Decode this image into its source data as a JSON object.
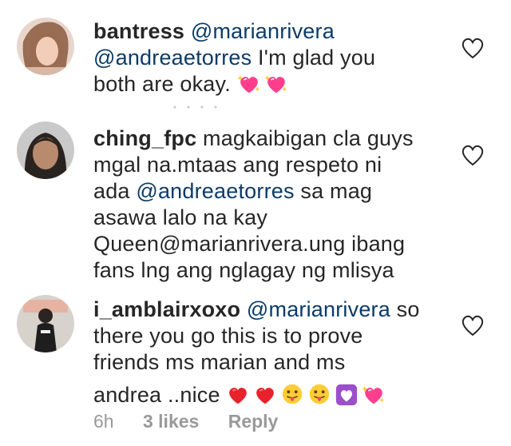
{
  "comments": [
    {
      "username": "bantress",
      "lines": [
        [
          {
            "t": "mention",
            "v": "@marianrivera"
          }
        ],
        [
          {
            "t": "mention",
            "v": "@andreaetorres"
          },
          {
            "t": "text",
            "v": " I'm glad you"
          }
        ],
        [
          {
            "t": "text",
            "v": "both are okay. "
          }
        ]
      ],
      "emojis": [
        "sparkling-heart",
        "sparkling-heart"
      ]
    },
    {
      "username": "ching_fpc",
      "line1_text": " magkaibigan cla guys",
      "line2": "mgal na.mtaas ang respeto ni",
      "line3_pre": "ada ",
      "line3_mention": "@andreaetorres",
      "line3_post": " sa mag",
      "line4": "asawa lalo na kay",
      "line5": "Queen@marianrivera.ung ibang",
      "line6": "fans lng ang nglagay ng mlisya"
    },
    {
      "username": "i_amblairxoxo",
      "line1_space": " ",
      "line1_mention": "@marianrivera",
      "line1_post": " so",
      "line2": "there you go this is to prove",
      "line3": "friends ms marian and ms",
      "line4": "andrea ..nice ",
      "emojis": [
        "red-heart",
        "red-heart",
        "tongue-face",
        "tongue-face",
        "purple-heart",
        "sparkling-heart"
      ]
    }
  ],
  "meta": {
    "time": "6h",
    "likes": "3 likes",
    "reply": "Reply"
  },
  "colors": {
    "mention": "#0b3b68",
    "meta": "#999999",
    "text": "#262626"
  }
}
